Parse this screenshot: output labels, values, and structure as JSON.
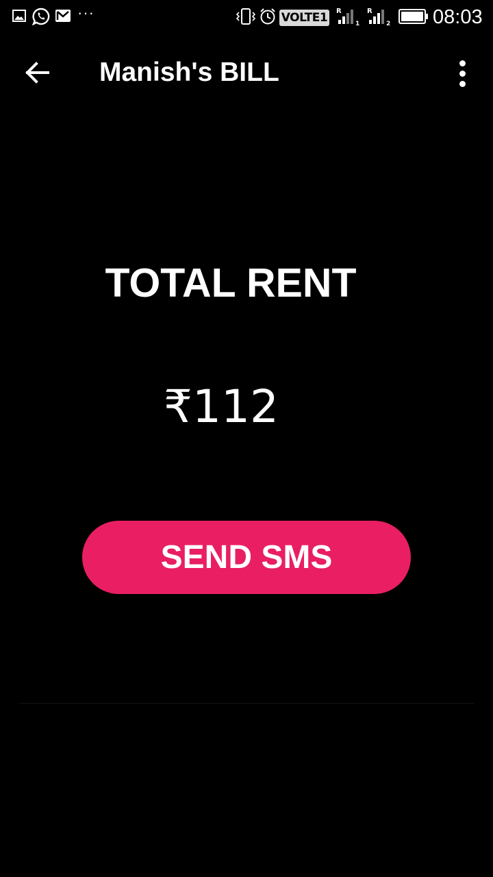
{
  "status_bar": {
    "time": "08:03",
    "volte_label": "VOLTE",
    "volte_slot": "1",
    "sim1_roaming": "R",
    "sim1_slot": "1",
    "sim2_roaming": "R",
    "sim2_slot": "2",
    "more_notifications": "···",
    "battery_level": 1.0,
    "icons": [
      "gallery-icon",
      "whatsapp-icon",
      "gmail-icon",
      "more-icon",
      "vibrate-icon",
      "alarm-icon",
      "signal-icon",
      "battery-icon"
    ]
  },
  "app_bar": {
    "title": "Manish's BILL",
    "back_icon": "arrow-back-icon",
    "menu_icon": "more-vert-icon"
  },
  "main": {
    "total_label": "TOTAL RENT",
    "amount": "₹112",
    "send_button_label": "SEND SMS"
  },
  "colors": {
    "background": "#000000",
    "accent": "#e91e63",
    "text": "#ffffff"
  }
}
